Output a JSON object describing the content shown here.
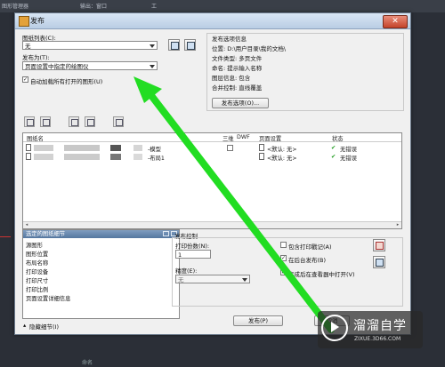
{
  "background": {
    "menu_items": [
      "图形管理器",
      "输出：窗口",
      "工"
    ],
    "bottom_text": "命名"
  },
  "dialog": {
    "title": "发布",
    "close_glyph": "✕",
    "sheet_list_label": "图纸列表(C):",
    "sheet_list_value": "无",
    "publish_to_label": "发布为(T):",
    "publish_to_value": "页面设置中指定的绘图仪",
    "auto_load_label": "自动加载所有打开的图形(U)",
    "auto_load_checked": "✓",
    "info_title": "发布选项信息",
    "info_rows": [
      "位置: D:\\用户目录\\我的文档\\",
      "文件类型: 多页文件",
      "命名: 提示输入名称",
      "图层信息: 包含",
      "合并控制: 直线覆盖"
    ],
    "publish_options_button": "发布选项(O)...",
    "table": {
      "col_sheet_name": "图纸名",
      "col_3d": "三维",
      "col_dwf": "DWF",
      "col_page_setup": "页面设置",
      "col_status": "状态",
      "rows": [
        {
          "name_suffix": "-模型",
          "page_setup": "<默认: 无>",
          "status": "无错误"
        },
        {
          "name_suffix": "-布局1",
          "page_setup": "<默认: 无>",
          "status": "无错误"
        }
      ],
      "check_glyph": "✔",
      "scroll_left": "◂",
      "scroll_right": "▸"
    },
    "details": {
      "header": "选定的图纸细节",
      "items": [
        "源图形",
        "图形位置",
        "布局名称",
        "打印设备",
        "打印尺寸",
        "打印比例",
        "页面设置详细信息"
      ]
    },
    "hide_details": "隐藏细节(I)",
    "hide_details_arrow": "▴",
    "publish_control_title": "发布控制",
    "copies_label": "打印份数(N):",
    "copies_value": "1",
    "precision_label": "精度(E):",
    "precision_value": "无",
    "include_stamp_label": "包含打印戳记(A)",
    "background_publish_label": "在后台发布(B)",
    "background_publish_checked": "✓",
    "open_viewer_label": "完成后在查看器中打开(V)",
    "open_viewer_checked": "✓",
    "publish_button": "发布(P)",
    "cancel_button": "取消"
  },
  "watermark": {
    "brand": "溜溜自学",
    "url": "ZIXUE.3D66.COM"
  },
  "colors": {
    "arrow": "#22dd22",
    "header_blue": "#55779f",
    "ok_green": "#1a9a1a"
  }
}
